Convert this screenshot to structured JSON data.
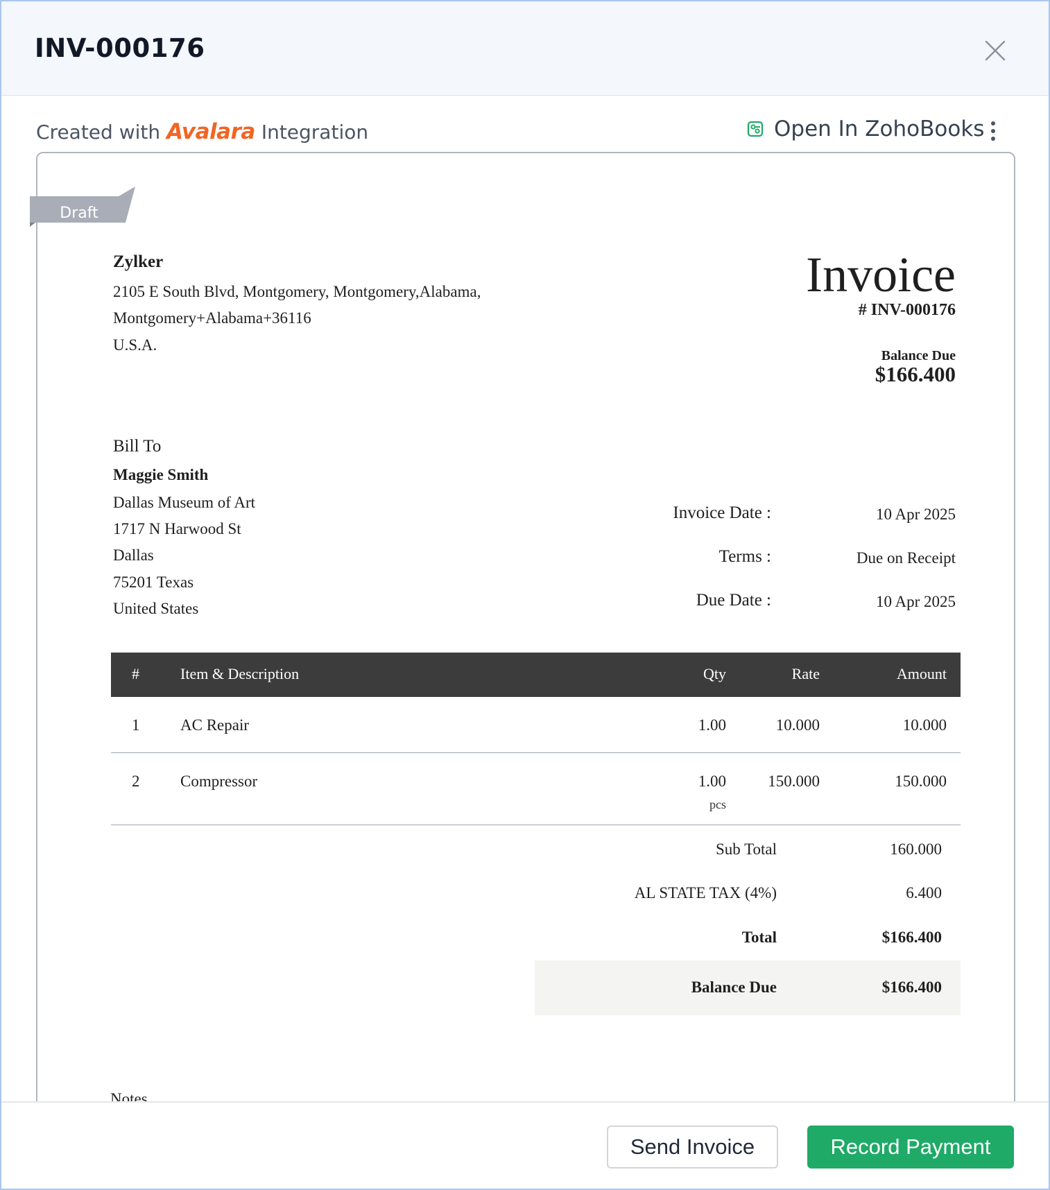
{
  "modal": {
    "title": "INV-000176"
  },
  "integration": {
    "prefix": "Created with",
    "brand": "Avalara",
    "suffix": "Integration"
  },
  "actions": {
    "open_in": "Open In ZohoBooks"
  },
  "invoice": {
    "status": "Draft",
    "org": {
      "name": "Zylker",
      "address_lines": [
        "2105 E South Blvd, Montgomery, Montgomery,Alabama,",
        "Montgomery+Alabama+36116",
        "U.S.A."
      ]
    },
    "title": "Invoice",
    "number": "# INV-000176",
    "balance_due_label": "Balance Due",
    "balance_due": "$166.400",
    "bill_to": {
      "label": "Bill To",
      "name": "Maggie Smith",
      "lines": [
        "Dallas Museum of Art",
        "1717 N Harwood St",
        "Dallas",
        "75201 Texas",
        "United States"
      ]
    },
    "meta": [
      {
        "label": "Invoice Date :",
        "value": "10 Apr 2025"
      },
      {
        "label": "Terms :",
        "value": "Due on Receipt"
      },
      {
        "label": "Due Date :",
        "value": "10 Apr 2025"
      }
    ],
    "table": {
      "headers": {
        "num": "#",
        "item": "Item & Description",
        "qty": "Qty",
        "rate": "Rate",
        "amount": "Amount"
      },
      "rows": [
        {
          "num": "1",
          "item": "AC Repair",
          "qty": "1.00",
          "unit": "",
          "rate": "10.000",
          "amount": "10.000"
        },
        {
          "num": "2",
          "item": "Compressor",
          "qty": "1.00",
          "unit": "pcs",
          "rate": "150.000",
          "amount": "150.000"
        }
      ]
    },
    "totals": {
      "subtotal_label": "Sub Total",
      "subtotal": "160.000",
      "tax_label": "AL STATE TAX (4%)",
      "tax": "6.400",
      "total_label": "Total",
      "total": "$166.400",
      "balance_label": "Balance Due",
      "balance": "$166.400"
    },
    "notes_label": "Notes"
  },
  "footer": {
    "send_label": "Send Invoice",
    "record_label": "Record Payment"
  },
  "colors": {
    "brand_orange": "#f26522",
    "primary_green": "#1faa68",
    "ribbon_gray": "#a8adb8",
    "table_header": "#3c3c3c"
  }
}
